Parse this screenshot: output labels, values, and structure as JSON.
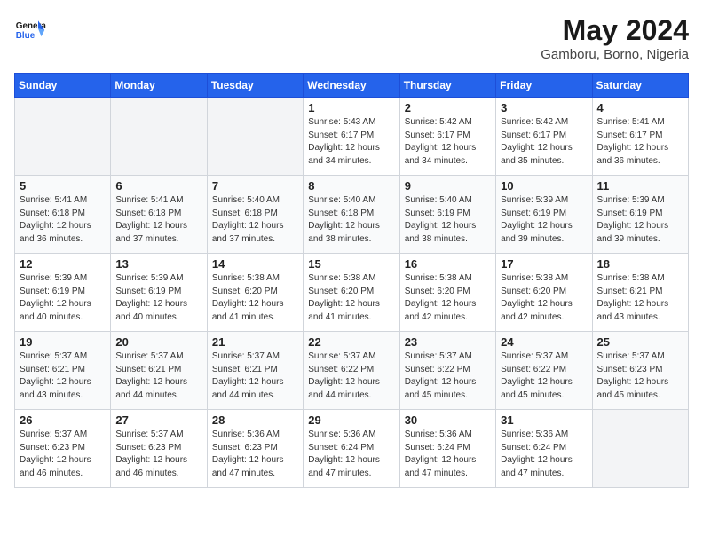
{
  "logo": {
    "line1": "General",
    "line2": "Blue"
  },
  "title": "May 2024",
  "subtitle": "Gamboru, Borno, Nigeria",
  "days_of_week": [
    "Sunday",
    "Monday",
    "Tuesday",
    "Wednesday",
    "Thursday",
    "Friday",
    "Saturday"
  ],
  "weeks": [
    [
      {
        "day": "",
        "info": ""
      },
      {
        "day": "",
        "info": ""
      },
      {
        "day": "",
        "info": ""
      },
      {
        "day": "1",
        "info": "Sunrise: 5:43 AM\nSunset: 6:17 PM\nDaylight: 12 hours\nand 34 minutes."
      },
      {
        "day": "2",
        "info": "Sunrise: 5:42 AM\nSunset: 6:17 PM\nDaylight: 12 hours\nand 34 minutes."
      },
      {
        "day": "3",
        "info": "Sunrise: 5:42 AM\nSunset: 6:17 PM\nDaylight: 12 hours\nand 35 minutes."
      },
      {
        "day": "4",
        "info": "Sunrise: 5:41 AM\nSunset: 6:17 PM\nDaylight: 12 hours\nand 36 minutes."
      }
    ],
    [
      {
        "day": "5",
        "info": "Sunrise: 5:41 AM\nSunset: 6:18 PM\nDaylight: 12 hours\nand 36 minutes."
      },
      {
        "day": "6",
        "info": "Sunrise: 5:41 AM\nSunset: 6:18 PM\nDaylight: 12 hours\nand 37 minutes."
      },
      {
        "day": "7",
        "info": "Sunrise: 5:40 AM\nSunset: 6:18 PM\nDaylight: 12 hours\nand 37 minutes."
      },
      {
        "day": "8",
        "info": "Sunrise: 5:40 AM\nSunset: 6:18 PM\nDaylight: 12 hours\nand 38 minutes."
      },
      {
        "day": "9",
        "info": "Sunrise: 5:40 AM\nSunset: 6:19 PM\nDaylight: 12 hours\nand 38 minutes."
      },
      {
        "day": "10",
        "info": "Sunrise: 5:39 AM\nSunset: 6:19 PM\nDaylight: 12 hours\nand 39 minutes."
      },
      {
        "day": "11",
        "info": "Sunrise: 5:39 AM\nSunset: 6:19 PM\nDaylight: 12 hours\nand 39 minutes."
      }
    ],
    [
      {
        "day": "12",
        "info": "Sunrise: 5:39 AM\nSunset: 6:19 PM\nDaylight: 12 hours\nand 40 minutes."
      },
      {
        "day": "13",
        "info": "Sunrise: 5:39 AM\nSunset: 6:19 PM\nDaylight: 12 hours\nand 40 minutes."
      },
      {
        "day": "14",
        "info": "Sunrise: 5:38 AM\nSunset: 6:20 PM\nDaylight: 12 hours\nand 41 minutes."
      },
      {
        "day": "15",
        "info": "Sunrise: 5:38 AM\nSunset: 6:20 PM\nDaylight: 12 hours\nand 41 minutes."
      },
      {
        "day": "16",
        "info": "Sunrise: 5:38 AM\nSunset: 6:20 PM\nDaylight: 12 hours\nand 42 minutes."
      },
      {
        "day": "17",
        "info": "Sunrise: 5:38 AM\nSunset: 6:20 PM\nDaylight: 12 hours\nand 42 minutes."
      },
      {
        "day": "18",
        "info": "Sunrise: 5:38 AM\nSunset: 6:21 PM\nDaylight: 12 hours\nand 43 minutes."
      }
    ],
    [
      {
        "day": "19",
        "info": "Sunrise: 5:37 AM\nSunset: 6:21 PM\nDaylight: 12 hours\nand 43 minutes."
      },
      {
        "day": "20",
        "info": "Sunrise: 5:37 AM\nSunset: 6:21 PM\nDaylight: 12 hours\nand 44 minutes."
      },
      {
        "day": "21",
        "info": "Sunrise: 5:37 AM\nSunset: 6:21 PM\nDaylight: 12 hours\nand 44 minutes."
      },
      {
        "day": "22",
        "info": "Sunrise: 5:37 AM\nSunset: 6:22 PM\nDaylight: 12 hours\nand 44 minutes."
      },
      {
        "day": "23",
        "info": "Sunrise: 5:37 AM\nSunset: 6:22 PM\nDaylight: 12 hours\nand 45 minutes."
      },
      {
        "day": "24",
        "info": "Sunrise: 5:37 AM\nSunset: 6:22 PM\nDaylight: 12 hours\nand 45 minutes."
      },
      {
        "day": "25",
        "info": "Sunrise: 5:37 AM\nSunset: 6:23 PM\nDaylight: 12 hours\nand 45 minutes."
      }
    ],
    [
      {
        "day": "26",
        "info": "Sunrise: 5:37 AM\nSunset: 6:23 PM\nDaylight: 12 hours\nand 46 minutes."
      },
      {
        "day": "27",
        "info": "Sunrise: 5:37 AM\nSunset: 6:23 PM\nDaylight: 12 hours\nand 46 minutes."
      },
      {
        "day": "28",
        "info": "Sunrise: 5:36 AM\nSunset: 6:23 PM\nDaylight: 12 hours\nand 47 minutes."
      },
      {
        "day": "29",
        "info": "Sunrise: 5:36 AM\nSunset: 6:24 PM\nDaylight: 12 hours\nand 47 minutes."
      },
      {
        "day": "30",
        "info": "Sunrise: 5:36 AM\nSunset: 6:24 PM\nDaylight: 12 hours\nand 47 minutes."
      },
      {
        "day": "31",
        "info": "Sunrise: 5:36 AM\nSunset: 6:24 PM\nDaylight: 12 hours\nand 47 minutes."
      },
      {
        "day": "",
        "info": ""
      }
    ]
  ]
}
